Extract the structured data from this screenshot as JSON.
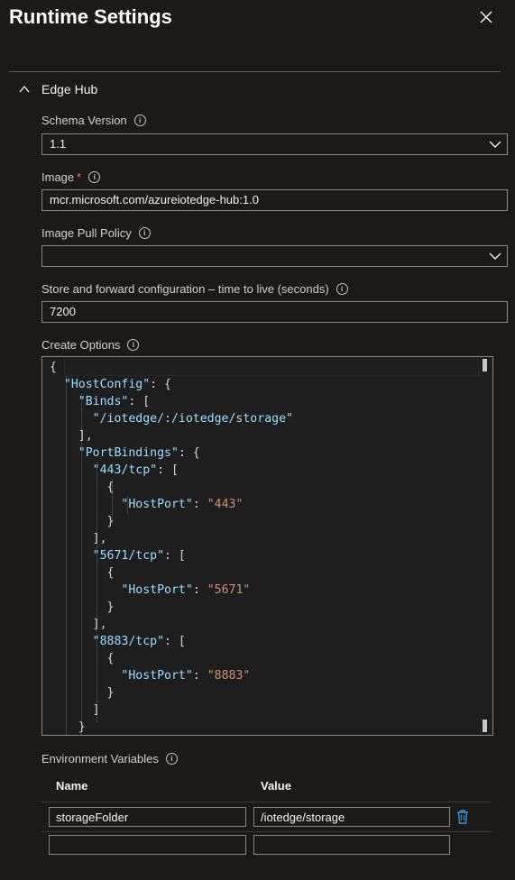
{
  "page": {
    "title": "Runtime Settings"
  },
  "section": {
    "label": "Edge Hub"
  },
  "schema_version": {
    "label": "Schema Version",
    "value": "1.1"
  },
  "image": {
    "label": "Image",
    "required_mark": "*",
    "value": "mcr.microsoft.com/azureiotedge-hub:1.0"
  },
  "image_pull_policy": {
    "label": "Image Pull Policy",
    "value": ""
  },
  "store_forward": {
    "label": "Store and forward configuration – time to live (seconds)",
    "value": "7200"
  },
  "create_options": {
    "label": "Create Options",
    "lines": [
      "{",
      "  \"HostConfig\": {",
      "    \"Binds\": [",
      "      \"/iotedge/:/iotedge/storage\"",
      "    ],",
      "    \"PortBindings\": {",
      "      \"443/tcp\": [",
      "        {",
      "          \"HostPort\": \"443\"",
      "        }",
      "      ],",
      "      \"5671/tcp\": [",
      "        {",
      "          \"HostPort\": \"5671\"",
      "        }",
      "      ],",
      "      \"8883/tcp\": [",
      "        {",
      "          \"HostPort\": \"8883\"",
      "        }",
      "      ]",
      "    }"
    ]
  },
  "env_vars": {
    "label": "Environment Variables",
    "columns": [
      "Name",
      "Value"
    ],
    "rows": [
      {
        "name": "storageFolder",
        "value": "/iotedge/storage"
      },
      {
        "name": "",
        "value": ""
      }
    ]
  },
  "icons": {
    "close": "close-icon",
    "collapse": "chevron-up-icon",
    "info": "info-icon",
    "dropdown": "chevron-down-icon",
    "delete": "trash-icon"
  },
  "colors": {
    "accent": "#3a96dd",
    "required": "#f1707b",
    "json_key": "#9cdcfe",
    "json_string": "#ce9178"
  }
}
